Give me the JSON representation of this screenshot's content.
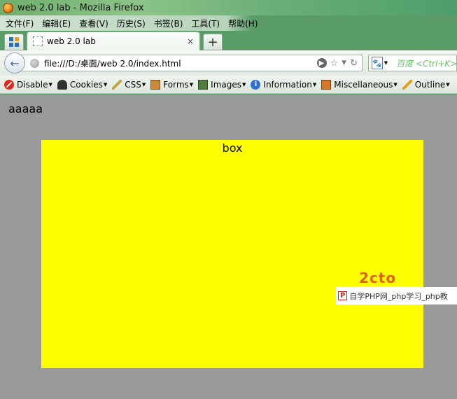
{
  "window": {
    "title": "web 2.0 lab - Mozilla Firefox"
  },
  "menubar": {
    "items": [
      {
        "label": "文件(F)"
      },
      {
        "label": "编辑(E)"
      },
      {
        "label": "查看(V)"
      },
      {
        "label": "历史(S)"
      },
      {
        "label": "书签(B)"
      },
      {
        "label": "工具(T)"
      },
      {
        "label": "帮助(H)"
      }
    ]
  },
  "tabs": {
    "active_title": "web 2.0 lab",
    "close_glyph": "×",
    "new_tab_glyph": "+"
  },
  "navbar": {
    "url": "file:///D:/桌面/web 2.0/index.html",
    "search_placeholder": "百度 <Ctrl+K>",
    "search_engine_icon": "baidu-icon"
  },
  "devtoolbar": {
    "items": [
      {
        "label": "Disable",
        "icon": "disable-icon"
      },
      {
        "label": "Cookies",
        "icon": "cookies-icon"
      },
      {
        "label": "CSS",
        "icon": "css-icon"
      },
      {
        "label": "Forms",
        "icon": "forms-icon"
      },
      {
        "label": "Images",
        "icon": "images-icon"
      },
      {
        "label": "Information",
        "icon": "information-icon"
      },
      {
        "label": "Miscellaneous",
        "icon": "miscellaneous-icon"
      },
      {
        "label": "Outline",
        "icon": "outline-icon"
      }
    ]
  },
  "page": {
    "text": "aaaaa",
    "box_label": "box",
    "background_color": "#999999",
    "box_color": "#ffff00"
  },
  "watermark": {
    "logo": "P",
    "text": "自学PHP网_php学习_php教",
    "brand": "2cto"
  }
}
